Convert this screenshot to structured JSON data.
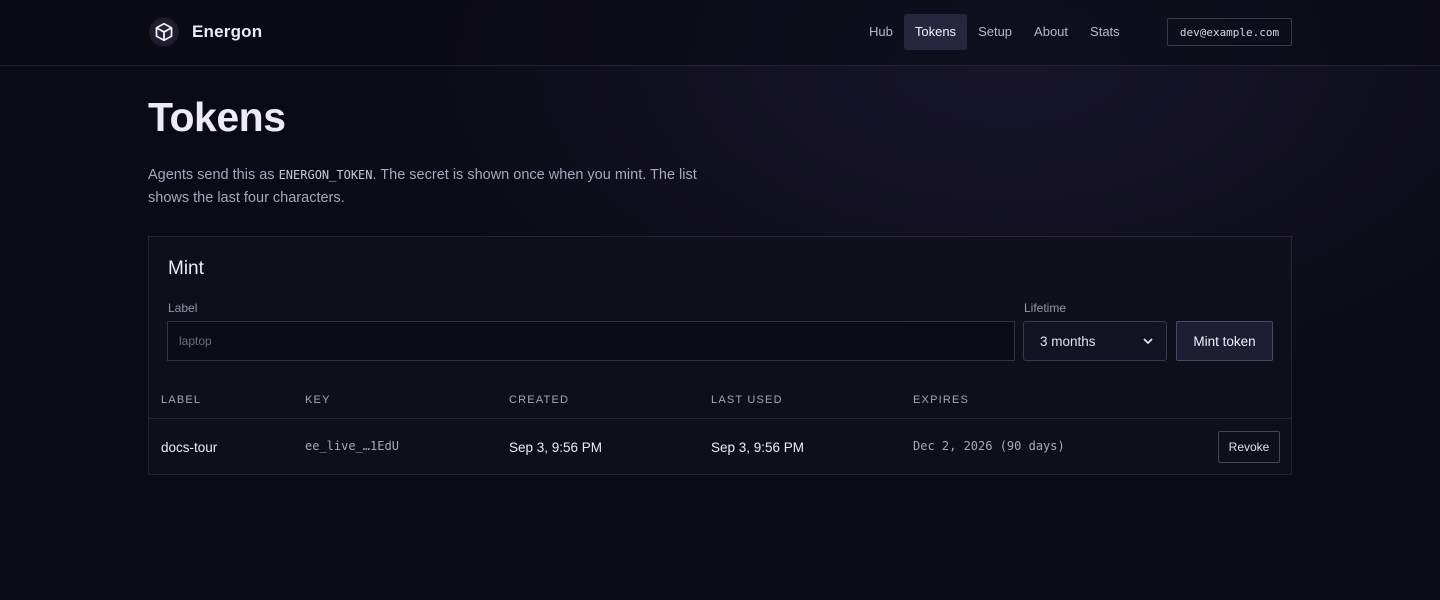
{
  "header": {
    "brand": "Energon",
    "nav": [
      "Hub",
      "Tokens",
      "Setup",
      "About",
      "Stats"
    ],
    "active_nav": "Tokens",
    "user_email": "dev@example.com"
  },
  "page": {
    "title": "Tokens",
    "desc_before": "Agents send this as ",
    "desc_code": "ENERGON_TOKEN",
    "desc_after": ". The secret is shown once when you mint. The list shows the last four characters."
  },
  "mint": {
    "title": "Mint",
    "label_field_label": "Label",
    "label_placeholder": "laptop",
    "lifetime_label": "Lifetime",
    "lifetime_value": "3 months",
    "mint_button": "Mint token"
  },
  "table": {
    "headers": [
      "LABEL",
      "KEY",
      "CREATED",
      "LAST USED",
      "EXPIRES"
    ],
    "rows": [
      {
        "label": "docs-tour",
        "key": "ee_live_…1EdU",
        "created": "Sep 3, 9:56 PM",
        "last_used": "Sep 3, 9:56 PM",
        "expires": "Dec 2, 2026 (90 days)",
        "action": "Revoke"
      }
    ]
  },
  "colors": {
    "background": "#0b0b16",
    "active_nav_bg": "#28253f",
    "panel_border": "#262533"
  },
  "icons": {
    "brand": "cube-icon",
    "select": "chevron-down-icon"
  }
}
